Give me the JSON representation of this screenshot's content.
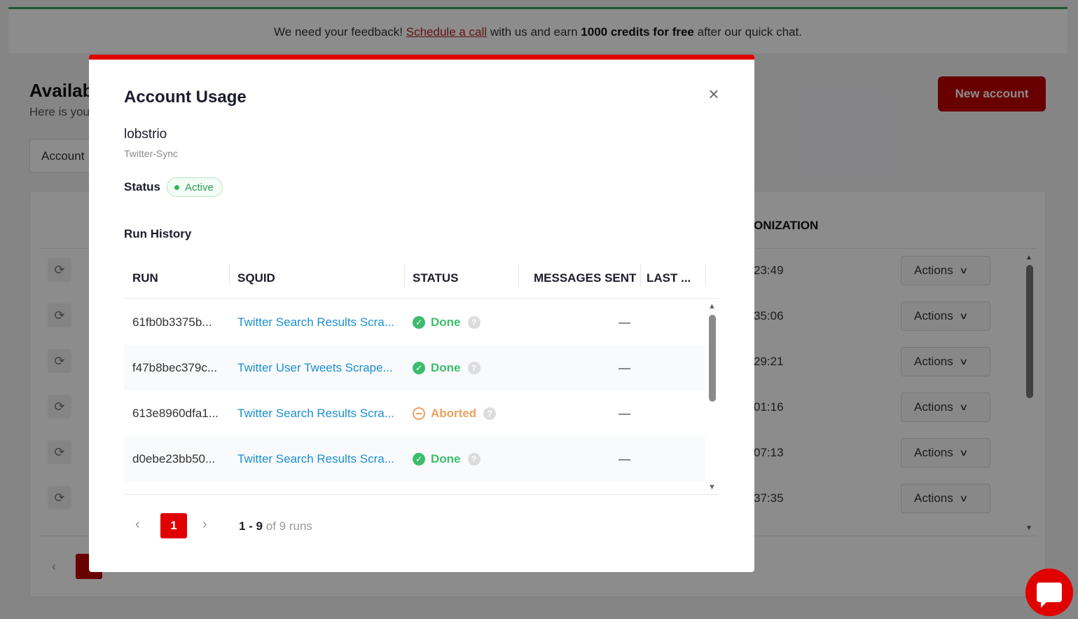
{
  "banner": {
    "prefix": "We need your feedback!",
    "link": "Schedule a call",
    "middle": "with us and earn",
    "bold": "1000 credits for free",
    "suffix": "after our quick chat."
  },
  "background": {
    "title": "Availab",
    "subtitle": "Here is you",
    "filter_label": "Account",
    "new_account_label": "New account",
    "column_header": "ONIZATION",
    "rows": [
      {
        "time": "23:49",
        "actions": "Actions"
      },
      {
        "time": "35:06",
        "actions": "Actions"
      },
      {
        "time": "29:21",
        "actions": "Actions"
      },
      {
        "time": "01:16",
        "actions": "Actions"
      },
      {
        "time": "07:13",
        "actions": "Actions"
      },
      {
        "time": "37:35",
        "actions": "Actions"
      }
    ]
  },
  "modal": {
    "title": "Account Usage",
    "close_icon": "close-icon",
    "account_name": "lobstrio",
    "account_type": "Twitter-Sync",
    "status_label": "Status",
    "status_value": "Active",
    "status_color": "#2e9e58",
    "section_title": "Run History",
    "columns": {
      "run": "RUN",
      "squid": "SQUID",
      "status": "STATUS",
      "messages": "MESSAGES SENT",
      "last": "LAST ..."
    },
    "rows": [
      {
        "run": "61fb0b3375b...",
        "squid": "Twitter Search Results Scra...",
        "status": "Done",
        "messages": "—"
      },
      {
        "run": "f47b8bec379c...",
        "squid": "Twitter User Tweets Scrape...",
        "status": "Done",
        "messages": "—"
      },
      {
        "run": "613e8960dfa1...",
        "squid": "Twitter Search Results Scra...",
        "status": "Aborted",
        "messages": "—"
      },
      {
        "run": "d0ebe23bb50...",
        "squid": "Twitter Search Results Scra...",
        "status": "Done",
        "messages": "—"
      }
    ],
    "pagination": {
      "current_page": "1",
      "range": "1 - 9",
      "of_text": "of 9 runs"
    }
  },
  "colors": {
    "accent": "#e00000",
    "done": "#3dbd6d",
    "aborted": "#eea05c",
    "link": "#1b8fd0"
  }
}
